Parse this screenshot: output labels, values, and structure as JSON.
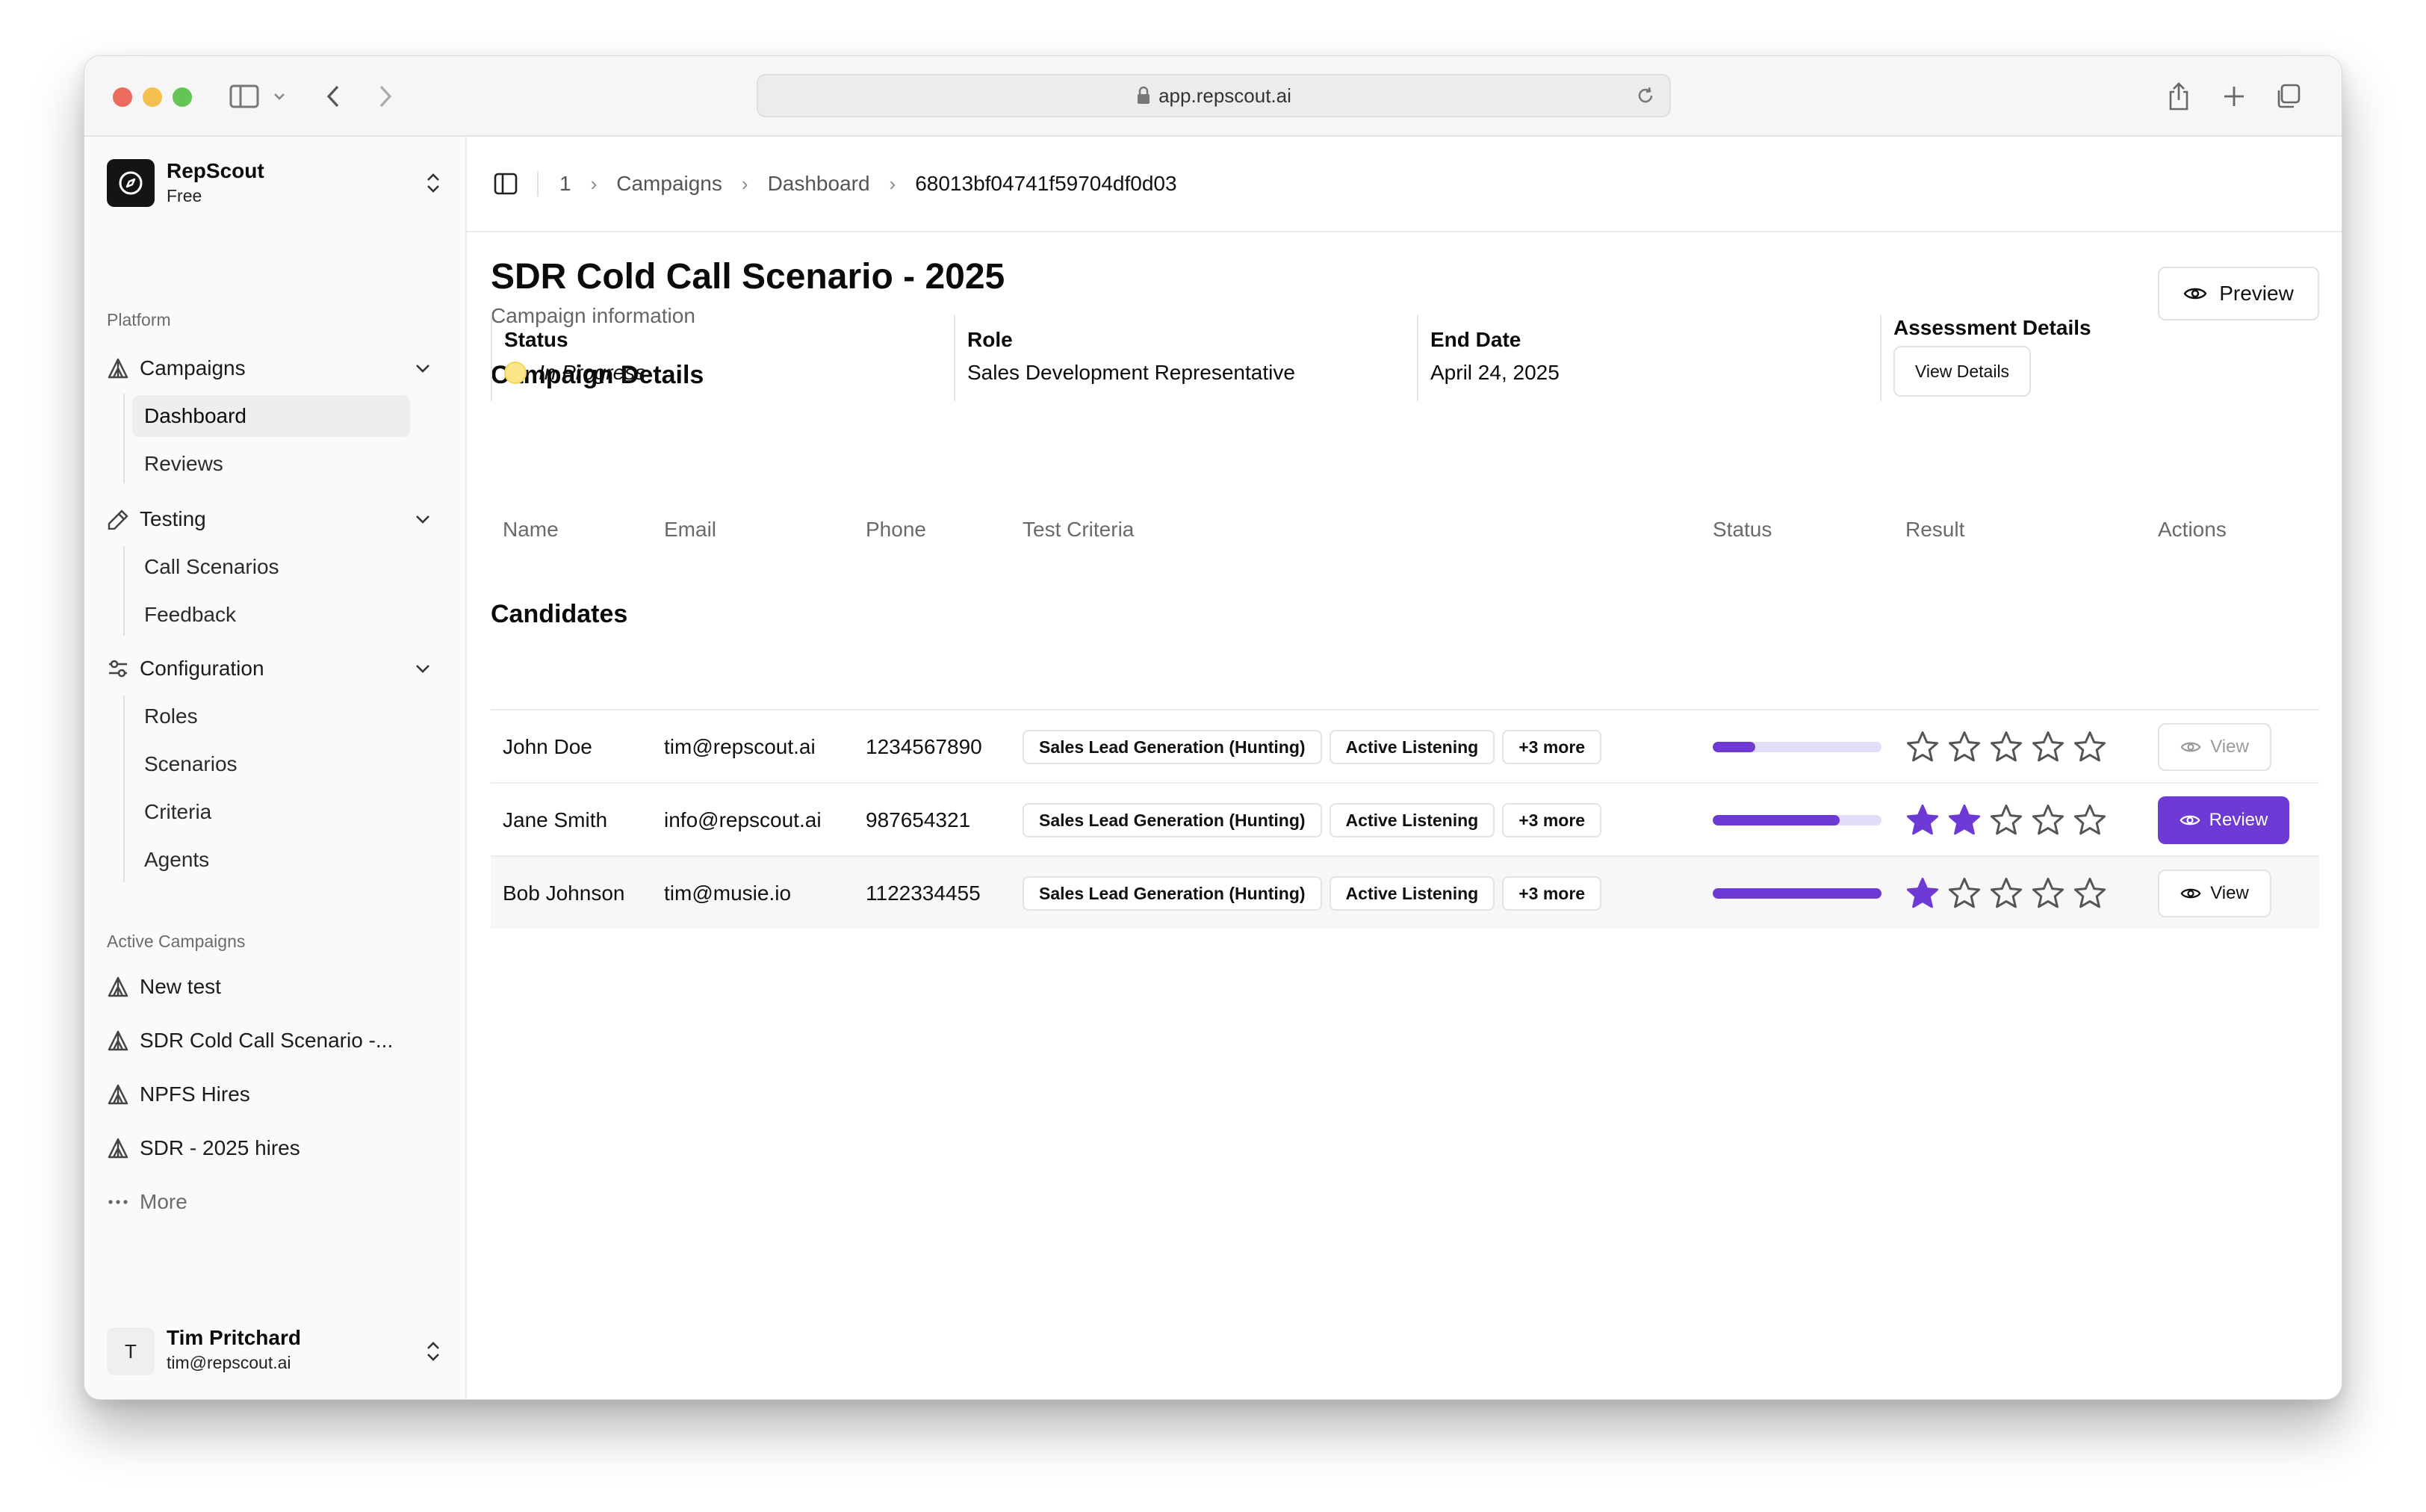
{
  "browser": {
    "url": "app.repscout.ai"
  },
  "sidebar": {
    "org_name": "RepScout",
    "org_plan": "Free",
    "platform_label": "Platform",
    "groups": [
      {
        "label": "Campaigns",
        "items": [
          "Dashboard",
          "Reviews"
        ]
      },
      {
        "label": "Testing",
        "items": [
          "Call Scenarios",
          "Feedback"
        ]
      },
      {
        "label": "Configuration",
        "items": [
          "Roles",
          "Scenarios",
          "Criteria",
          "Agents"
        ]
      }
    ],
    "active_campaigns_label": "Active Campaigns",
    "active_campaigns": [
      "New test",
      "SDR Cold Call Scenario -...",
      "NPFS Hires",
      "SDR - 2025 hires"
    ],
    "more_label": "More",
    "user": {
      "initial": "T",
      "name": "Tim Pritchard",
      "email": "tim@repscout.ai"
    }
  },
  "breadcrumb": [
    "1",
    "Campaigns",
    "Dashboard",
    "68013bf04741f59704df0d03"
  ],
  "page": {
    "title": "SDR Cold Call Scenario - 2025",
    "subtitle": "Campaign information",
    "preview_label": "Preview"
  },
  "details": {
    "heading": "Campaign Details",
    "status_label": "Status",
    "status_value": "In Progress",
    "status_color": "#fbe68a",
    "role_label": "Role",
    "role_value": "Sales Development Representative",
    "end_date_label": "End Date",
    "end_date_value": "April 24, 2025",
    "assessment_label": "Assessment Details",
    "view_details_label": "View Details"
  },
  "candidates": {
    "heading": "Candidates",
    "columns": [
      "Name",
      "Email",
      "Phone",
      "Test Criteria",
      "Status",
      "Result",
      "Actions"
    ],
    "rows": [
      {
        "name": "John Doe",
        "email": "tim@repscout.ai",
        "phone": "1234567890",
        "criteria": [
          "Sales Lead Generation (Hunting)",
          "Active Listening",
          "+3 more"
        ],
        "progress": 0.25,
        "stars": 0,
        "action": "View"
      },
      {
        "name": "Jane Smith",
        "email": "info@repscout.ai",
        "phone": "987654321",
        "criteria": [
          "Sales Lead Generation (Hunting)",
          "Active Listening",
          "+3 more"
        ],
        "progress": 0.75,
        "stars": 2,
        "action": "Review"
      },
      {
        "name": "Bob Johnson",
        "email": "tim@musie.io",
        "phone": "1122334455",
        "criteria": [
          "Sales Lead Generation (Hunting)",
          "Active Listening",
          "+3 more"
        ],
        "progress": 1.0,
        "stars": 1,
        "action": "View"
      }
    ]
  },
  "colors": {
    "accent": "#6e3ad6",
    "accent_light": "#e3dcf7"
  }
}
